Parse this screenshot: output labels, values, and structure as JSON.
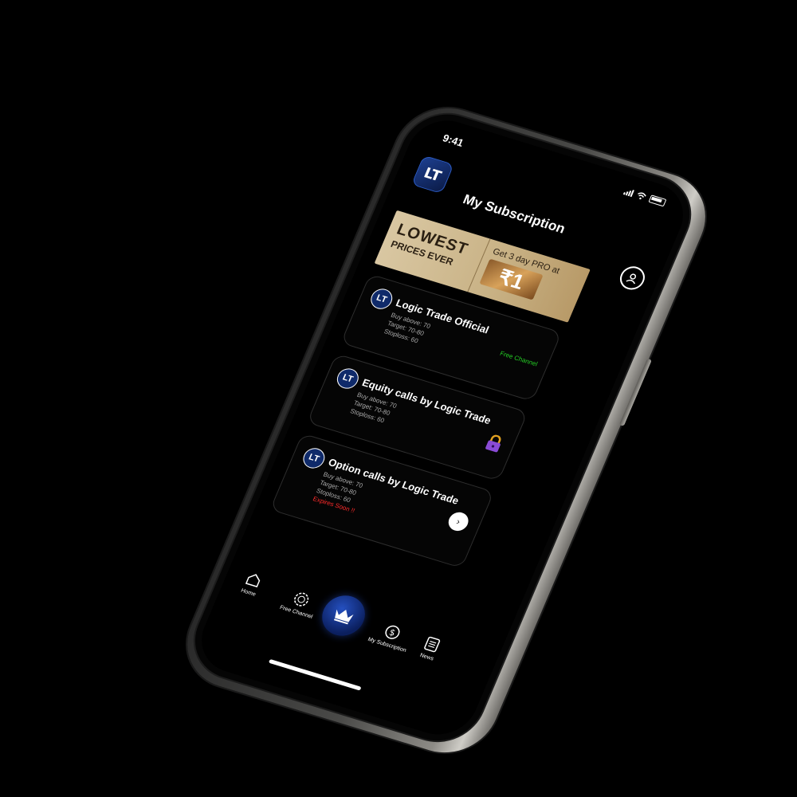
{
  "status": {
    "time": "9:41"
  },
  "header": {
    "logo_text": "LT",
    "title": "My Subscription"
  },
  "banner": {
    "headline": "LOWEST",
    "subline": "PRICES EVER",
    "offer": "Get 3 day PRO at",
    "price": "₹1"
  },
  "cards": [
    {
      "logo_text": "LT",
      "title": "Logic Trade Official",
      "buy": "Buy above: 70",
      "target": "Target: 70-80",
      "stoploss": "Stoploss: 60",
      "tag": "Free Channel"
    },
    {
      "logo_text": "LT",
      "title": "Equity calls by Logic Trade",
      "buy": "Buy above: 70",
      "target": "Target: 70-80",
      "stoploss": "Stoploss: 60",
      "status_icon": "lock-icon"
    },
    {
      "logo_text": "LT",
      "title": "Option calls by Logic Trade",
      "buy": "Buy above: 70",
      "target": "Target: 70-80",
      "stoploss": "Stoploss: 60",
      "warning": "Expires Soon !!",
      "action_icon": "chevron-right-icon"
    }
  ],
  "nav": {
    "home": "Home",
    "free_channel": "Free Channel",
    "my_subscription": "My Subscription",
    "news": "News",
    "center_icon": "crown-icon"
  },
  "colors": {
    "background": "#000000",
    "brand_blue": "#1d3f8f",
    "free_green": "#25d025",
    "warning_red": "#ff2a2a",
    "lock_purple": "#8a4bd6"
  }
}
